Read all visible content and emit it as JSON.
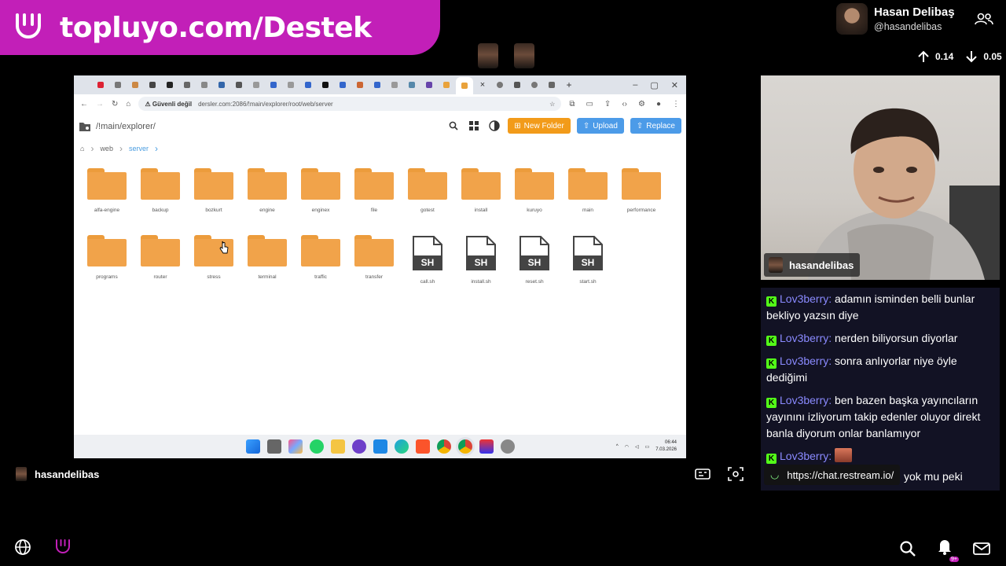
{
  "banner": {
    "text": "topluyo.com/Destek"
  },
  "profile": {
    "name": "Hasan Delibaş",
    "handle": "@hasandelibas"
  },
  "stats": {
    "up": "0.14",
    "down": "0.05"
  },
  "browser": {
    "address": {
      "security": "Güvenli değil",
      "url": "dersler.com:2086/!main/explorer/root/web/server"
    },
    "explorer_title": "/!main/explorer/",
    "buttons": {
      "new_folder": "New Folder",
      "upload": "Upload",
      "replace": "Replace"
    },
    "breadcrumb": [
      "web",
      "server"
    ],
    "items": [
      {
        "name": "alfa-engine",
        "type": "folder"
      },
      {
        "name": "backup",
        "type": "folder"
      },
      {
        "name": "bozkurt",
        "type": "folder"
      },
      {
        "name": "engine",
        "type": "folder"
      },
      {
        "name": "enginex",
        "type": "folder"
      },
      {
        "name": "file",
        "type": "folder"
      },
      {
        "name": "gotest",
        "type": "folder"
      },
      {
        "name": "install",
        "type": "folder"
      },
      {
        "name": "kuruyo",
        "type": "folder"
      },
      {
        "name": "main",
        "type": "folder"
      },
      {
        "name": "performance",
        "type": "folder"
      },
      {
        "name": "programs",
        "type": "folder"
      },
      {
        "name": "router",
        "type": "folder"
      },
      {
        "name": "stress",
        "type": "folder"
      },
      {
        "name": "terminal",
        "type": "folder"
      },
      {
        "name": "traffic",
        "type": "folder"
      },
      {
        "name": "transfer",
        "type": "folder"
      },
      {
        "name": "call.sh",
        "type": "sh"
      },
      {
        "name": "install.sh",
        "type": "sh"
      },
      {
        "name": "reset.sh",
        "type": "sh"
      },
      {
        "name": "start.sh",
        "type": "sh"
      }
    ],
    "file_badge": "SH",
    "clock": {
      "time": "06:44",
      "date": "7.03.2026"
    }
  },
  "cam": {
    "label": "hasandelibas"
  },
  "chat": {
    "messages": [
      {
        "user": "Lov3berry",
        "text": "adamın isminden belli bunlar bekliyo yazsın diye"
      },
      {
        "user": "Lov3berry",
        "text": "nerden biliyorsun diyorlar"
      },
      {
        "user": "Lov3berry",
        "text": "sonra anlıyorlar niye öyle dediğimi"
      },
      {
        "user": "Lov3berry",
        "text": "ben bazen başka yayıncıların yayınını izliyorum takip edenler oluyor direkt banla diyorum onlar banlamıyor"
      }
    ],
    "last_user": "Lov3berry",
    "restream_url": "https://chat.restream.io/",
    "partial_text": "yok mu peki"
  },
  "streamer": {
    "name": "hasandelibas"
  },
  "notifications": {
    "badge": "9+"
  },
  "colors": {
    "brand": "#c21fb8",
    "chat_user": "#8a8aff",
    "kick": "#53fc18"
  }
}
